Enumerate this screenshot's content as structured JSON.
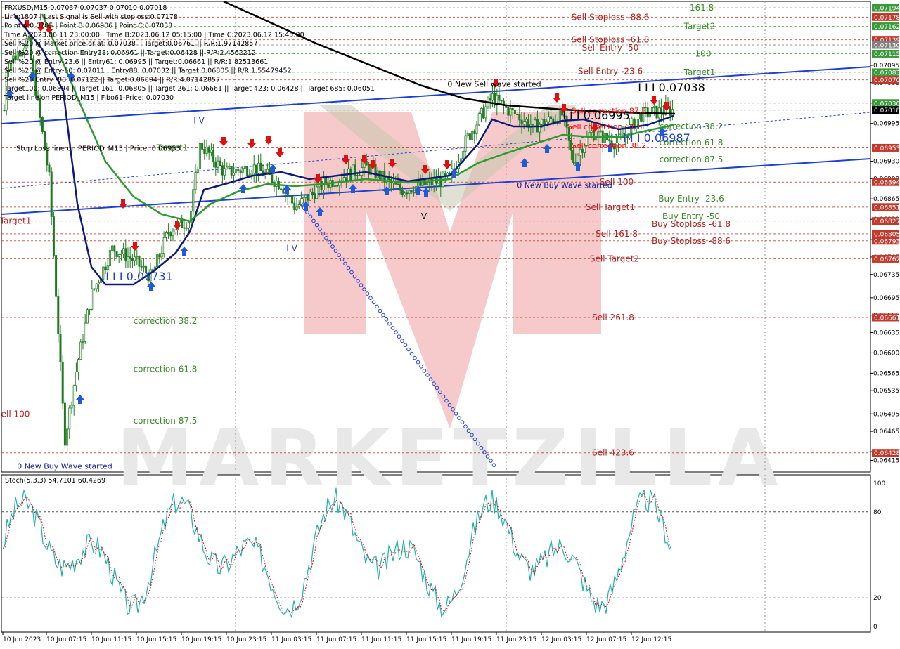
{
  "colors": {
    "background": "#ffffff",
    "grid": "#9a9a9a",
    "candle": "#1f7a1f",
    "ma_black": "#000000",
    "ma_navy": "#0d1a7a",
    "ma_green": "#2f9a2f",
    "trend_blue": "#1f3fd1",
    "sell_red": "#b22222",
    "target_green": "#3a8a2a",
    "arrow_down": "#e01010",
    "arrow_up": "#1f5ad8",
    "stoch_main": "#20b2aa",
    "stoch_signal": "#d01010",
    "price_tag": "#c0392b",
    "price_tag_green": "#3a9a3a",
    "price_tag_white": "#808080"
  },
  "header": {
    "lines": [
      "FRXUSD,M15  0.07037 0.07037 0.07010 0.07018",
      "Line:1807 | Last Signal is:Sell with stoploss:0.07178",
      "Point A:0.0705 | Point B:0.06906 | Point C:0.07038",
      "Time A:2023.06.11 23:00:00 | Time B:2023.06.12 05:15:00 | Time C:2023.06.12 15:45:00",
      "Sell %20 @ Market price or at: 0.07038 || Target:0.06761 || R/R:1.97142857",
      "Sell %20 @ correction Entry38: 0.06961 || Target:0.06428 || R/R:2.4562212",
      "Sell %20 @ Entry-23.6 || Entry61: 0.06995 || Target:0.06661 || R/R:1.82513661",
      "Sell %20 @ Entry-50: 0.07011 | Entry88: 0.07032 || Target:0.06805 || R/R:1.55479452",
      "Sell %20 Entry -88: 0.07122 || Target:0.06894 || R/R:4.07142857",
      "Target100: 0.06894 || Target 161: 0.06805 || Target 261: 0.06661 || Target 423: 0.06428 || Target 685: 0.06051",
      "Target line on PERIOD_M15 | Fibo61-Price: 0.07030"
    ]
  },
  "chart_data": {
    "type": "candlestick",
    "symbol": "FRXUSD",
    "timeframe": "M15",
    "ylim": [
      0.06395,
      0.07205
    ],
    "y_ticks": [
      "0.07095",
      "0.07065",
      "0.07030",
      "0.06995",
      "0.06930",
      "0.06900",
      "0.06865",
      "0.06830",
      "0.06795",
      "0.06765",
      "0.06735",
      "0.06695",
      "0.06665",
      "0.06635",
      "0.06600",
      "0.06565",
      "0.06535",
      "0.06495",
      "0.06465",
      "0.06430",
      "0.06415"
    ],
    "x_ticks": [
      "10 Jun 2023",
      "10 Jun 07:15",
      "10 Jun 11:15",
      "10 Jun 15:15",
      "10 Jun 19:15",
      "10 Jun 23:15",
      "11 Jun 03:15",
      "11 Jun 07:15",
      "11 Jun 11:15",
      "11 Jun 15:15",
      "11 Jun 19:15",
      "11 Jun 23:15",
      "12 Jun 03:15",
      "12 Jun 07:15",
      "12 Jun 12:15"
    ],
    "price_tags": [
      {
        "value": "0.07194",
        "price": 0.07194,
        "color": "green"
      },
      {
        "value": "0.07178",
        "price": 0.07178,
        "color": "red"
      },
      {
        "value": "0.07162",
        "price": 0.07162,
        "color": "green"
      },
      {
        "value": "0.07139",
        "price": 0.07139,
        "color": "red"
      },
      {
        "value": "0.07130",
        "price": 0.0713,
        "color": "gray"
      },
      {
        "value": "0.07115",
        "price": 0.07115,
        "color": "green"
      },
      {
        "value": "0.07083",
        "price": 0.07083,
        "color": "green"
      },
      {
        "value": "0.07070",
        "price": 0.0707,
        "color": "red"
      },
      {
        "value": "0.07030",
        "price": 0.0703,
        "color": "green"
      },
      {
        "value": "0.07018",
        "price": 0.07018,
        "color": "black"
      },
      {
        "value": "0.06953",
        "price": 0.06953,
        "color": "red"
      },
      {
        "value": "0.06894",
        "price": 0.06894,
        "color": "red"
      },
      {
        "value": "0.06851",
        "price": 0.06851,
        "color": "red"
      },
      {
        "value": "0.06827",
        "price": 0.06827,
        "color": "red"
      },
      {
        "value": "0.06805",
        "price": 0.06805,
        "color": "red"
      },
      {
        "value": "0.06793",
        "price": 0.06793,
        "color": "red"
      },
      {
        "value": "0.06762",
        "price": 0.06762,
        "color": "red"
      },
      {
        "value": "0.06661",
        "price": 0.06661,
        "color": "red"
      },
      {
        "value": "0.06428",
        "price": 0.06428,
        "color": "red"
      }
    ],
    "levels": [
      {
        "label": "Sell Stoploss -88.6",
        "price": 0.07178,
        "color": "red",
        "x": 868
      },
      {
        "label": "Sell Stoploss -61.8",
        "price": 0.07139,
        "color": "red",
        "x": 868
      },
      {
        "label": "Sell Entry -50",
        "price": 0.07125,
        "color": "red",
        "x": 868
      },
      {
        "label": "Sell Entry -23.6",
        "price": 0.07085,
        "color": "red",
        "x": 868
      },
      {
        "label": "161.8",
        "price": 0.07194,
        "color": "green",
        "x": 998
      },
      {
        "label": "Target2",
        "price": 0.07162,
        "color": "green",
        "x": 995
      },
      {
        "label": "100",
        "price": 0.07115,
        "color": "green",
        "x": 1000
      },
      {
        "label": "Target1",
        "price": 0.07083,
        "color": "green",
        "x": 995
      },
      {
        "label": "correction 38.2",
        "price": 0.0699,
        "color": "green",
        "x": 983
      },
      {
        "label": "correction 61.8",
        "price": 0.06962,
        "color": "green",
        "x": 983
      },
      {
        "label": "correction 87.5",
        "price": 0.06933,
        "color": "green",
        "x": 983
      },
      {
        "label": "Buy Entry -23.6",
        "price": 0.06865,
        "color": "green",
        "x": 983
      },
      {
        "label": "Buy Entry -50",
        "price": 0.06835,
        "color": "green",
        "x": 983
      },
      {
        "label": "Buy Stoploss -61.8",
        "price": 0.06822,
        "color": "red",
        "x": 983
      },
      {
        "label": "Buy Stoploss -88.6",
        "price": 0.06793,
        "color": "red",
        "x": 983
      },
      {
        "label": "Sell 100",
        "price": 0.06894,
        "color": "red",
        "x": 877
      },
      {
        "label": "Sell Target1",
        "price": 0.06851,
        "color": "red",
        "x": 868
      },
      {
        "label": "Sell 161.8",
        "price": 0.06805,
        "color": "red",
        "x": 877
      },
      {
        "label": "Sell Target2",
        "price": 0.06762,
        "color": "red",
        "x": 874
      },
      {
        "label": "Sell  261.8",
        "price": 0.06661,
        "color": "red",
        "x": 872
      },
      {
        "label": "Sell  423.6",
        "price": 0.06428,
        "color": "red",
        "x": 872
      },
      {
        "label": "correction 38.2",
        "price": 0.06655,
        "color": "green",
        "x": 235
      },
      {
        "label": "correction 61.8",
        "price": 0.06572,
        "color": "green",
        "x": 235
      },
      {
        "label": "correction 87.5",
        "price": 0.06483,
        "color": "green",
        "x": 235
      },
      {
        "label": "Target1",
        "price": 0.06953,
        "color": "green",
        "x": 245
      },
      {
        "label": "Target1",
        "price": 0.06827,
        "color": "red",
        "x": 22
      },
      {
        "label": "ell 100",
        "price": 0.06495,
        "color": "red",
        "x": 22
      }
    ],
    "annotations": [
      {
        "text": "0 New Sell wave started",
        "price": 0.07063,
        "x": 703,
        "color": "black",
        "size": 11
      },
      {
        "text": "0 New Buy Wave started",
        "price": 0.06889,
        "x": 803,
        "color": "#0d1a9a",
        "size": 11
      },
      {
        "text": "0 New Buy Wave started",
        "price": 0.06405,
        "x": 92,
        "color": "#0d1a9a",
        "size": 11
      },
      {
        "text": "Stop Loss line on PERIOD_M15 | Price: 0.06953",
        "price": 0.06953,
        "x": 140,
        "color": "black",
        "size": 10
      },
      {
        "text": "Sell correction 87.5",
        "price": 0.07017,
        "x": 866,
        "color": "red",
        "size": 11
      },
      {
        "text": "Sell correction 61.8",
        "price": 0.0699,
        "x": 860,
        "color": "red",
        "size": 11
      },
      {
        "text": "Sell correction 38.2",
        "price": 0.06957,
        "x": 866,
        "color": "red",
        "size": 11
      },
      {
        "text": "I I I 0.07038",
        "price": 0.07055,
        "x": 955,
        "color": "black",
        "size": 16
      },
      {
        "text": "I I I 0.06995",
        "price": 0.07007,
        "x": 848,
        "color": "black",
        "size": 16
      },
      {
        "text": "I I I 0.06987",
        "price": 0.06968,
        "x": 934,
        "color": "#1f3fd1",
        "size": 16
      },
      {
        "text": "I I I 0.06731",
        "price": 0.0673,
        "x": 198,
        "color": "#1f3fd1",
        "size": 16
      },
      {
        "text": "I V",
        "price": 0.0678,
        "x": 415,
        "color": "#1f3fd1",
        "size": 12
      },
      {
        "text": "V",
        "price": 0.06835,
        "x": 603,
        "color": "black",
        "size": 12
      },
      {
        "text": "I V",
        "price": 0.07,
        "x": 283,
        "color": "#1f3fd1",
        "size": 12
      }
    ],
    "watermark": "MARKETZILLA",
    "stoch": {
      "label": "Stoch(5,3,3) 54.7101 60.4269",
      "k": 54.7101,
      "d": 60.4269,
      "levels": [
        80,
        20
      ],
      "ylim": [
        0,
        100
      ],
      "y_ticks": [
        "100",
        "80",
        "20",
        "0"
      ]
    }
  }
}
